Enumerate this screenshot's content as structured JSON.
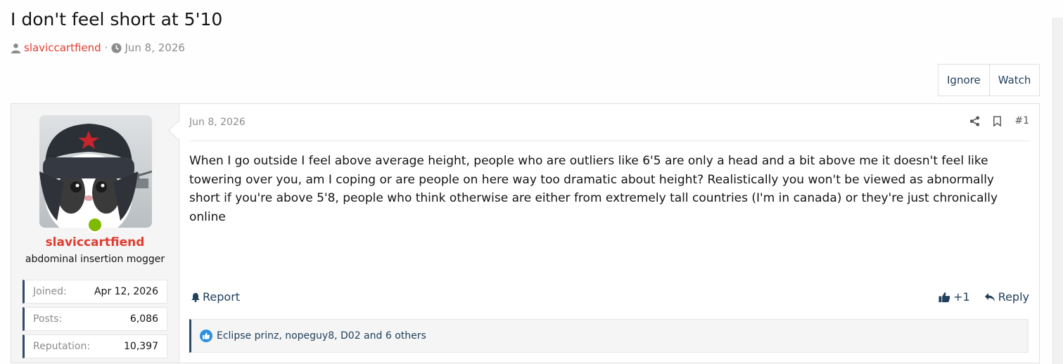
{
  "thread": {
    "title": "I don't feel short at 5'10",
    "author": "slaviccartfiend",
    "separator": "·",
    "date": "Jun 8, 2026"
  },
  "actions": {
    "ignore": "Ignore",
    "watch": "Watch"
  },
  "user": {
    "name": "slaviccartfiend",
    "title": "abdominal insertion mogger",
    "stats": [
      {
        "label": "Joined:",
        "value": "Apr 12, 2026"
      },
      {
        "label": "Posts:",
        "value": "6,086"
      },
      {
        "label": "Reputation:",
        "value": "10,397"
      }
    ]
  },
  "post": {
    "date": "Jun 8, 2026",
    "number": "#1",
    "body": "When I go outside I feel above average height, people who are outliers like 6'5 are only a head and a bit above me it doesn't feel like towering over you, am I coping or are people on here way too dramatic about height? Realistically you won't be viewed as abnormally short if you're above 5'8, people who think otherwise are either from extremely tall countries (I'm in canada) or they're just chronically online",
    "report": "Report",
    "like_count": "+1",
    "reply": "Reply",
    "reactions": "Eclipse prinz, nopeguy8, D02 and 6 others"
  },
  "icons": {
    "user": "user-icon",
    "clock": "clock-icon",
    "share": "share-icon",
    "bookmark": "bookmark-icon",
    "bell": "bell-icon",
    "thumbs_up": "thumbs-up-icon",
    "reply": "reply-icon",
    "like_reaction": "like-reaction-icon"
  },
  "colors": {
    "accent": "#e03c31",
    "link": "#21405c",
    "online": "#7fb900",
    "like": "#2f8fe0"
  }
}
